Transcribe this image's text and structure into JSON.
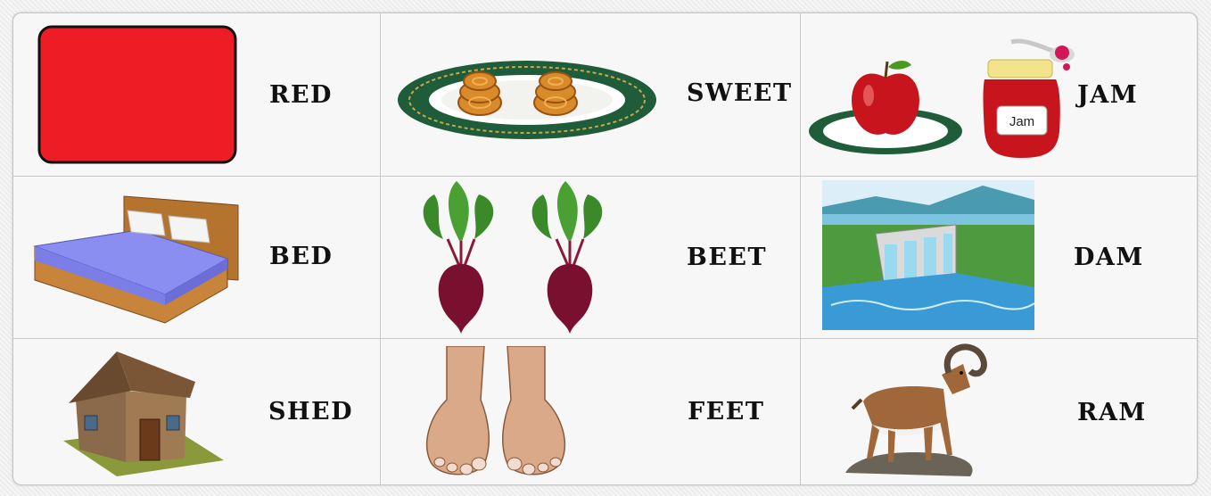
{
  "words": {
    "red": "RED",
    "sweet": "SWEET",
    "jam": "JAM",
    "bed": "BED",
    "beet": "BEET",
    "dam": "DAM",
    "shed": "SHED",
    "feet": "FEET",
    "ram": "RAM"
  },
  "jar_label": "Jam",
  "colors": {
    "red_swatch": "#ee1c25",
    "plate_rim": "#1e5c3a",
    "beet": "#7a1030",
    "bedsheet": "#8a8ef0",
    "water": "#3a9ad6"
  }
}
